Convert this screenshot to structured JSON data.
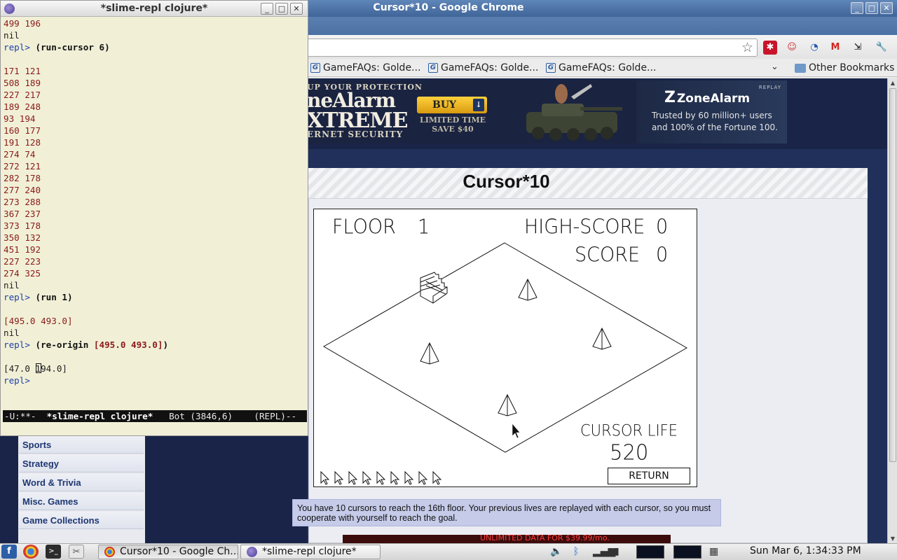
{
  "chrome": {
    "title": "Cursor*10 - Google Chrome",
    "bookmarks": [
      "GameFAQs: Golde...",
      "GameFAQs: Golde...",
      "GameFAQs: Golde..."
    ],
    "other_bookmarks": "Other Bookmarks"
  },
  "ad": {
    "line1": "UP YOUR PROTECTION",
    "line2": "neAlarm",
    "line3": "XTREME",
    "line4": "ERNET SECURITY",
    "buy": "BUY",
    "limited": "LIMITED TIME",
    "save": "SAVE $40",
    "brand": "ZoneAlarm",
    "replay": "REPLAY",
    "trust1": "Trusted by 60 million+ users",
    "trust2": "and 100% of the Fortune 100."
  },
  "game": {
    "title": "Cursor*10",
    "floor_label": "FLOOR",
    "floor_value": "1",
    "highscore_label": "HIGH-SCORE",
    "highscore_value": "0",
    "score_label": "SCORE",
    "score_value": "0",
    "life_label": "CURSOR LIFE",
    "life_value": "520",
    "return_label": "RETURN",
    "cursors_remaining": 9
  },
  "info_text": "You have 10 cursors to reach the 16th floor. Your previous lives are replayed with each cursor, so you must cooperate with yourself to reach the goal.",
  "banner2_text": "UNLIMITED DATA FOR $39.99/mo.",
  "sidebar": {
    "items": [
      "Sports",
      "Strategy",
      "Word & Trivia",
      "Misc. Games",
      "Game Collections"
    ]
  },
  "emacs": {
    "title": "*slime-repl clojure*",
    "modeline": {
      "status": "-U:**-  ",
      "buffer": "*slime-repl clojure*",
      "position": "   Bot (3846,6)    (REPL)--"
    },
    "lines": [
      {
        "type": "out",
        "text": "499 196"
      },
      {
        "type": "nil",
        "text": "nil"
      },
      {
        "type": "cmd",
        "prompt": "repl> ",
        "text": "(run-cursor 6)"
      },
      {
        "type": "blank",
        "text": ""
      },
      {
        "type": "out",
        "text": "171 121"
      },
      {
        "type": "out",
        "text": "508 189"
      },
      {
        "type": "out",
        "text": "227 217"
      },
      {
        "type": "out",
        "text": "189 248"
      },
      {
        "type": "out",
        "text": "93 194"
      },
      {
        "type": "out",
        "text": "160 177"
      },
      {
        "type": "out",
        "text": "191 128"
      },
      {
        "type": "out",
        "text": "274 74"
      },
      {
        "type": "out",
        "text": "272 121"
      },
      {
        "type": "out",
        "text": "282 178"
      },
      {
        "type": "out",
        "text": "277 240"
      },
      {
        "type": "out",
        "text": "273 288"
      },
      {
        "type": "out",
        "text": "367 237"
      },
      {
        "type": "out",
        "text": "373 178"
      },
      {
        "type": "out",
        "text": "350 132"
      },
      {
        "type": "out",
        "text": "451 192"
      },
      {
        "type": "out",
        "text": "227 223"
      },
      {
        "type": "out",
        "text": "274 325"
      },
      {
        "type": "nil",
        "text": "nil"
      },
      {
        "type": "cmd",
        "prompt": "repl> ",
        "text": "(run 1)"
      },
      {
        "type": "blank",
        "text": ""
      },
      {
        "type": "out",
        "text": "[495.0 493.0]"
      },
      {
        "type": "nil",
        "text": "nil"
      },
      {
        "type": "cmd",
        "prompt": "repl> ",
        "text": "(re-origin ",
        "arg": "[495.0 493.0]",
        "close": ")"
      },
      {
        "type": "blank",
        "text": ""
      },
      {
        "type": "point",
        "before": "[47.0 ",
        "at": "1",
        "after": "94.0]"
      },
      {
        "type": "prompt",
        "prompt": "repl> ",
        "text": ""
      }
    ]
  },
  "taskbar": {
    "tasks": [
      "Cursor*10 - Google Ch...",
      "*slime-repl clojure*"
    ],
    "clock": "Sun Mar  6,  1:34:33 PM"
  }
}
